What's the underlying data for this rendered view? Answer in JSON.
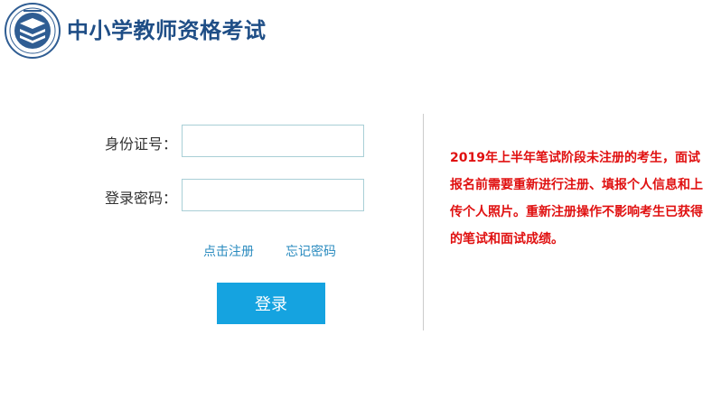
{
  "header": {
    "title": "中小学教师资格考试"
  },
  "login_form": {
    "id_label": "身份证号：",
    "password_label": "登录密码：",
    "id_value": "",
    "password_value": "",
    "register_link": "点击注册",
    "forgot_link": "忘记密码",
    "login_button": "登录"
  },
  "notice": {
    "text": "2019年上半年笔试阶段未注册的考生，面试报名前需要重新进行注册、填报个人信息和上传个人照片。重新注册操作不影响考生已获得的笔试和面试成绩。"
  },
  "colors": {
    "brand": "#1f4e86",
    "button": "#15a3e0",
    "link": "#2a8bbf",
    "notice": "#e01010"
  }
}
